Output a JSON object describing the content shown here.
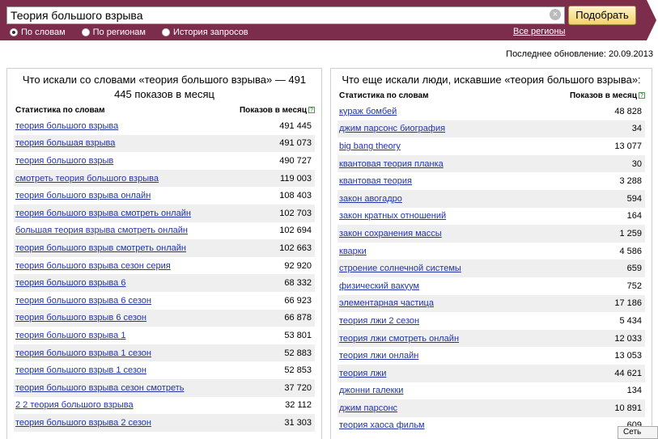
{
  "search": {
    "query": "Теория большого взрыва",
    "button_label": "Подобрать",
    "modes": [
      "По словам",
      "По регионам",
      "История запросов"
    ],
    "selected_mode": 0,
    "regions_link": "Все регионы"
  },
  "updated": "Последнее обновление: 20.09.2013",
  "left": {
    "title": "Что искали со словами «теория большого взрыва» — 491 445 показов в месяц",
    "col_phrase": "Статистика по словам",
    "col_count": "Показов в месяц",
    "rows": [
      {
        "phrase": "теория большого взрыва",
        "count": "491 445"
      },
      {
        "phrase": "теория большая взрыва",
        "count": "491 073"
      },
      {
        "phrase": "теория большого взрыв",
        "count": "490 727"
      },
      {
        "phrase": "смотреть теория большого взрыва",
        "count": "119 003"
      },
      {
        "phrase": "теория большого взрыва онлайн",
        "count": "108 403"
      },
      {
        "phrase": "теория большого взрыва смотреть онлайн",
        "count": "102 703"
      },
      {
        "phrase": "большая теория взрыва смотреть онлайн",
        "count": "102 694"
      },
      {
        "phrase": "теория большого взрыв смотреть онлайн",
        "count": "102 663"
      },
      {
        "phrase": "теория большого взрыва сезон серия",
        "count": "92 920"
      },
      {
        "phrase": "теория большого взрыва 6",
        "count": "68 332"
      },
      {
        "phrase": "теория большого взрыва 6 сезон",
        "count": "66 923"
      },
      {
        "phrase": "теория большого взрыв 6 сезон",
        "count": "66 878"
      },
      {
        "phrase": "теория большого взрыва 1",
        "count": "53 801"
      },
      {
        "phrase": "теория большого взрыва 1 сезон",
        "count": "52 883"
      },
      {
        "phrase": "теория большого взрыв 1 сезон",
        "count": "52 853"
      },
      {
        "phrase": "теория большого взрыва сезон смотреть",
        "count": "37 720"
      },
      {
        "phrase": "2 2 теория большого взрыва",
        "count": "32 112"
      },
      {
        "phrase": "теория большого взрыва 2 сезон",
        "count": "31 303"
      }
    ]
  },
  "right": {
    "title": "Что еще искали люди, искавшие «теория большого взрыва»:",
    "col_phrase": "Статистика по словам",
    "col_count": "Показов в месяц",
    "rows": [
      {
        "phrase": "кураж бомбей",
        "count": "48 828"
      },
      {
        "phrase": "джим парсонс биография",
        "count": "34"
      },
      {
        "phrase": "big bang theory",
        "count": "13 077"
      },
      {
        "phrase": "квантовая теория планка",
        "count": "30"
      },
      {
        "phrase": "квантовая теория",
        "count": "3 288"
      },
      {
        "phrase": "закон авогадро",
        "count": "594"
      },
      {
        "phrase": "закон кратных отношений",
        "count": "164"
      },
      {
        "phrase": "закон сохранения массы",
        "count": "1 259"
      },
      {
        "phrase": "кварки",
        "count": "4 586"
      },
      {
        "phrase": "строение солнечной системы",
        "count": "659"
      },
      {
        "phrase": "физический вакуум",
        "count": "752"
      },
      {
        "phrase": "элементарная частица",
        "count": "17 186"
      },
      {
        "phrase": "теория лжи 2 сезон",
        "count": "5 434"
      },
      {
        "phrase": "теория лжи смотреть онлайн",
        "count": "12 033"
      },
      {
        "phrase": "теория лжи онлайн",
        "count": "13 053"
      },
      {
        "phrase": "теория лжи",
        "count": "44 621"
      },
      {
        "phrase": "джонни галекки",
        "count": "134"
      },
      {
        "phrase": "джим парсонс",
        "count": "10 891"
      },
      {
        "phrase": "теория хаоса фильм",
        "count": "609"
      }
    ]
  },
  "tooltip": "Сеть",
  "colors": {
    "band": "#7d2d4c",
    "link": "#2233aa",
    "stripe": "#efefef"
  }
}
